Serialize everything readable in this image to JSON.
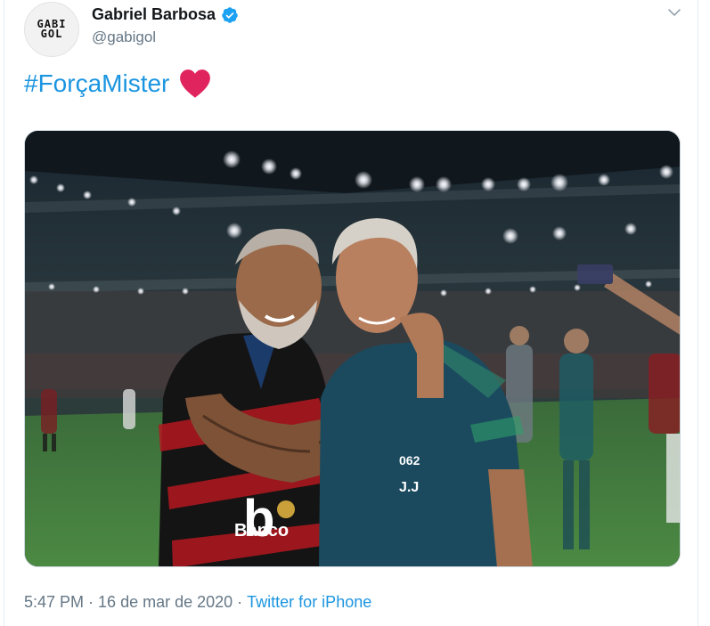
{
  "author": {
    "display_name": "Gabriel Barbosa",
    "handle": "@gabigol",
    "avatar_text": "GABI\nGOL",
    "verified": true,
    "verified_icon": "verified-badge-icon"
  },
  "menu": {
    "icon": "chevron-down-icon"
  },
  "tweet": {
    "hashtag": "#ForçaMister",
    "emoji_icon": "red-heart-icon",
    "heart_color": "#e0245e"
  },
  "media": {
    "description_icon": "photo",
    "jersey_text": "Banco",
    "jersey_partial": "b",
    "shirt_initials": "J.J",
    "shirt_number": "062"
  },
  "meta": {
    "time": "5:47 PM",
    "separator1": " · ",
    "date": "16 de mar de 2020",
    "separator2": " · ",
    "source": "Twitter for iPhone"
  },
  "colors": {
    "link": "#1b95e0",
    "secondary_text": "#657786",
    "verified": "#1da1f2"
  }
}
